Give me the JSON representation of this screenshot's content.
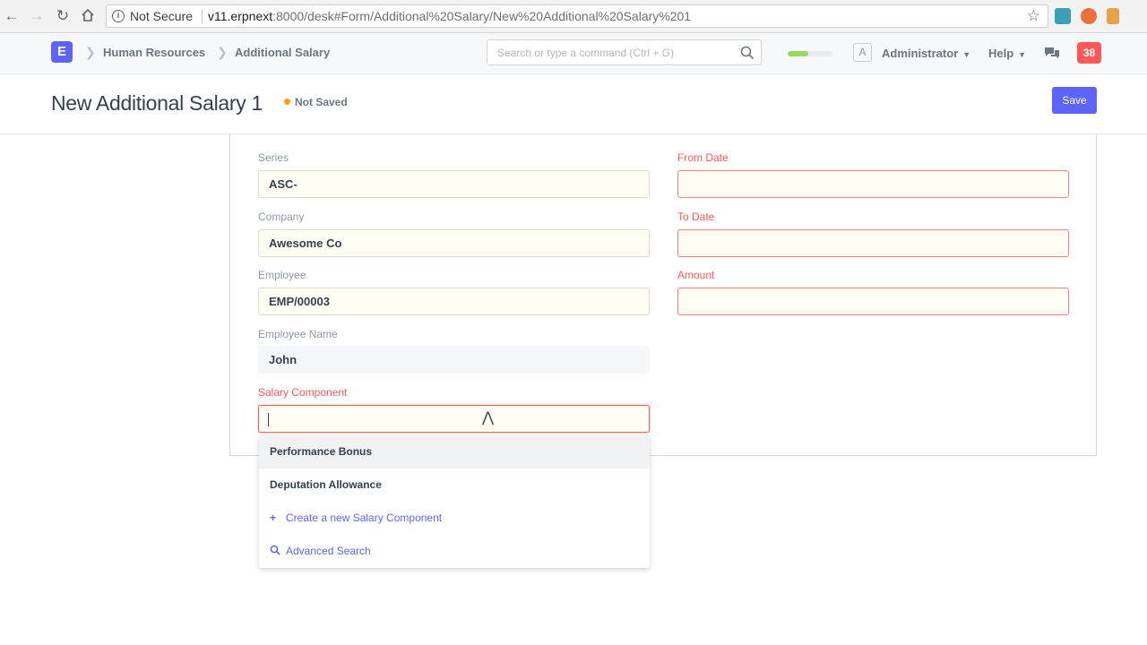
{
  "browser": {
    "security_label": "Not Secure",
    "url_host": "v11.erpnext",
    "url_rest": ":8000/desk#Form/Additional%20Salary/New%20Additional%20Salary%201"
  },
  "navbar": {
    "logo": "E",
    "breadcrumbs": [
      "Human Resources",
      "Additional Salary"
    ],
    "search_placeholder": "Search or type a command (Ctrl + G)",
    "progress_fraction": 0.45,
    "avatar_letter": "A",
    "user": "Administrator",
    "help": "Help",
    "notifications": "38"
  },
  "page": {
    "title": "New Additional Salary 1",
    "status": "Not Saved",
    "save_label": "Save"
  },
  "form": {
    "series_label": "Series",
    "series_value": "ASC-",
    "company_label": "Company",
    "company_value": "Awesome Co",
    "employee_label": "Employee",
    "employee_value": "EMP/00003",
    "employee_name_label": "Employee Name",
    "employee_name_value": "John",
    "salary_component_label": "Salary Component",
    "from_date_label": "From Date",
    "to_date_label": "To Date",
    "amount_label": "Amount"
  },
  "dropdown": {
    "items": [
      "Performance Bonus",
      "Deputation Allowance"
    ],
    "create_label": "Create a new Salary Component",
    "advanced_label": "Advanced Search"
  },
  "colors": {
    "primary": "#5e64ff",
    "required": "#ff5858",
    "notif": "#ff5858",
    "progress": "#98d85b",
    "status_dot": "#ffa00a"
  }
}
